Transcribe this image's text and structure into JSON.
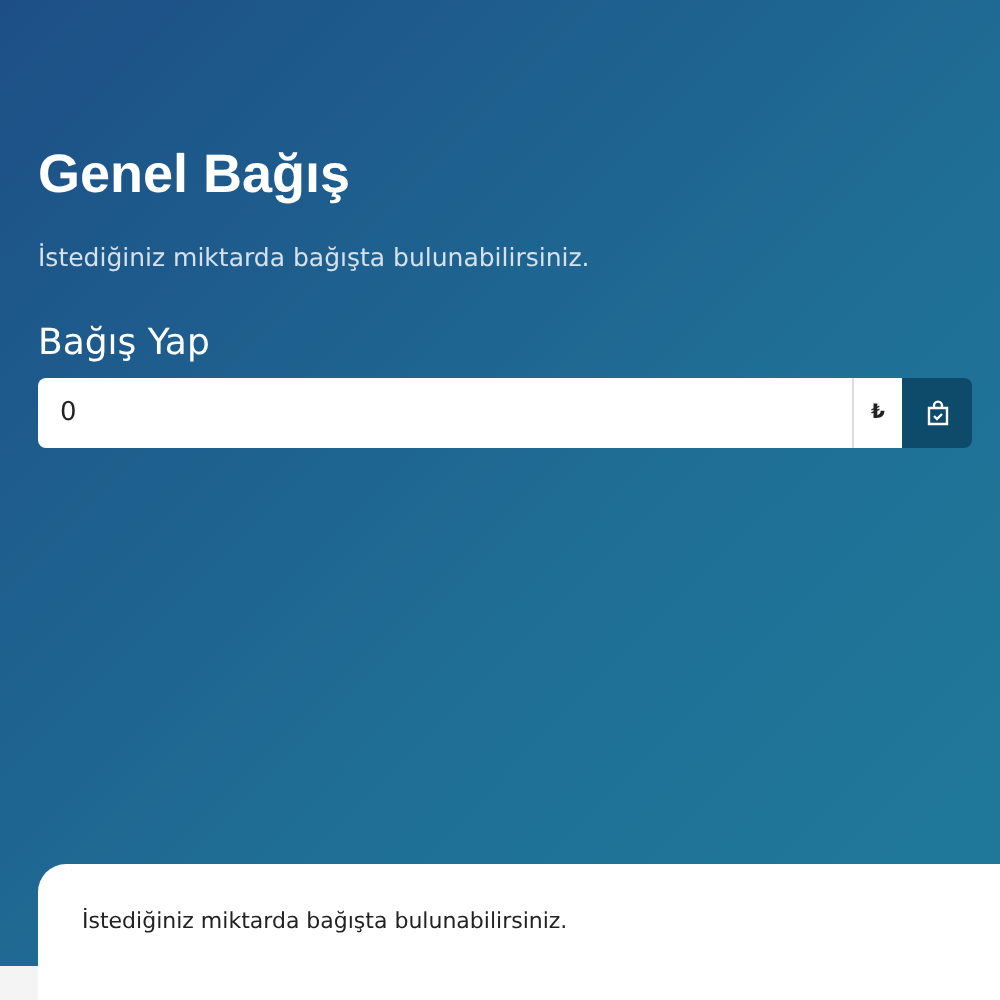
{
  "hero": {
    "title": "Genel Bağış",
    "subtitle": "İstediğiniz miktarda bağışta bulunabilirsiniz.",
    "form_label": "Bağış Yap",
    "amount": {
      "value": "0",
      "currency": "₺"
    }
  },
  "card": {
    "text": "İstediğiniz miktarda bağışta bulunabilirsiniz."
  }
}
